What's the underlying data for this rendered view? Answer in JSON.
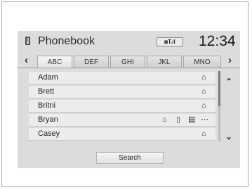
{
  "header": {
    "title": "Phonebook",
    "status": "◙T.ıl",
    "clock": "12:34"
  },
  "tabs": [
    {
      "label": "ABC",
      "active": true
    },
    {
      "label": "DEF",
      "active": false
    },
    {
      "label": "GHI",
      "active": false
    },
    {
      "label": "JKL",
      "active": false
    },
    {
      "label": "MNO",
      "active": false
    }
  ],
  "contacts": [
    {
      "name": "Adam",
      "icons": [
        "home-icon"
      ]
    },
    {
      "name": "Brett",
      "icons": [
        "home-icon"
      ]
    },
    {
      "name": "Britni",
      "icons": [
        "home-icon"
      ]
    },
    {
      "name": "Bryan",
      "icons": [
        "home-icon",
        "mobile-icon",
        "office-icon",
        "more-icon"
      ]
    },
    {
      "name": "Casey",
      "icons": [
        "home-icon"
      ]
    }
  ],
  "search_button": "Search",
  "colors": {
    "screen": "#dcdcdc",
    "row": "#ececec"
  }
}
